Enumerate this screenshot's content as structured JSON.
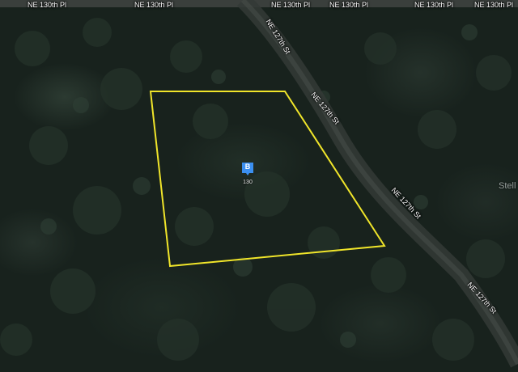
{
  "top_street_labels": [
    "NE 130th Pl",
    "NE 130th Pl",
    "NE 130th Pl",
    "NE 130th Pl",
    "NE 130th Pl",
    "NE 130th Pl"
  ],
  "road_labels": [
    "NE 127th St",
    "NE 127th St",
    "NE 127th St",
    "NE 127th St"
  ],
  "marker": {
    "badge": "B",
    "id": "130",
    "color": "#3b8ff0"
  },
  "edge_text": "Stell",
  "colors": {
    "boundary": "#f0e52a",
    "road": "#3a3f3c",
    "canopy": "#18221d"
  }
}
